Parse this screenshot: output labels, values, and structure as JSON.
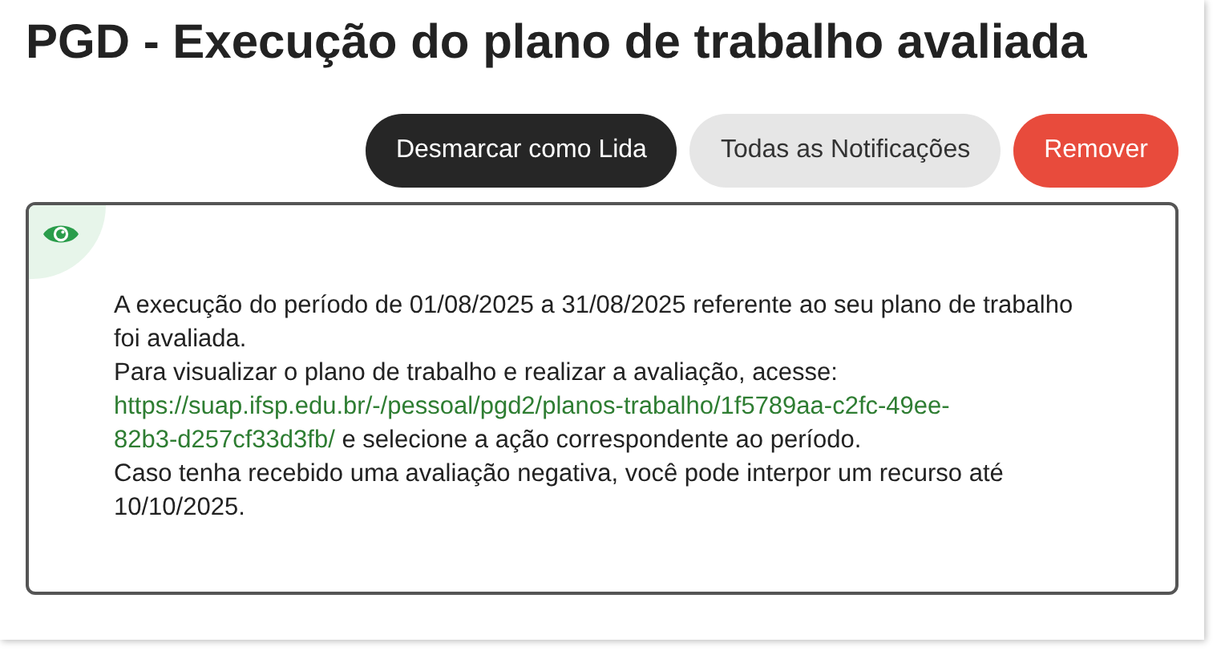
{
  "title": "PGD - Execução do plano de trabalho avaliada",
  "buttons": [
    {
      "label": "Desmarcar como Lida",
      "kind": "dark"
    },
    {
      "label": "Todas as Notificações",
      "kind": "light"
    },
    {
      "label": "Remover",
      "kind": "danger"
    }
  ],
  "notification": {
    "read": true,
    "paragraphs": [
      {
        "text": "A execução do período de 01/08/2025 a 31/08/2025 referente ao seu plano de trabalho foi avaliada."
      },
      {
        "text": "Para visualizar o plano de trabalho e realizar a avaliação, acesse:",
        "link": [
          "https://suap.ifsp.edu.br/-/pessoal/pgd2/planos-trabalho/1f5789aa-c2fc-49ee-",
          "82b3-d257cf33d3fb/"
        ],
        "after": "e selecione a ação correspondente ao período."
      },
      {
        "text": "Caso tenha recebido uma avaliação negativa, você pode interpor um recurso até 10/10/2025."
      }
    ]
  }
}
